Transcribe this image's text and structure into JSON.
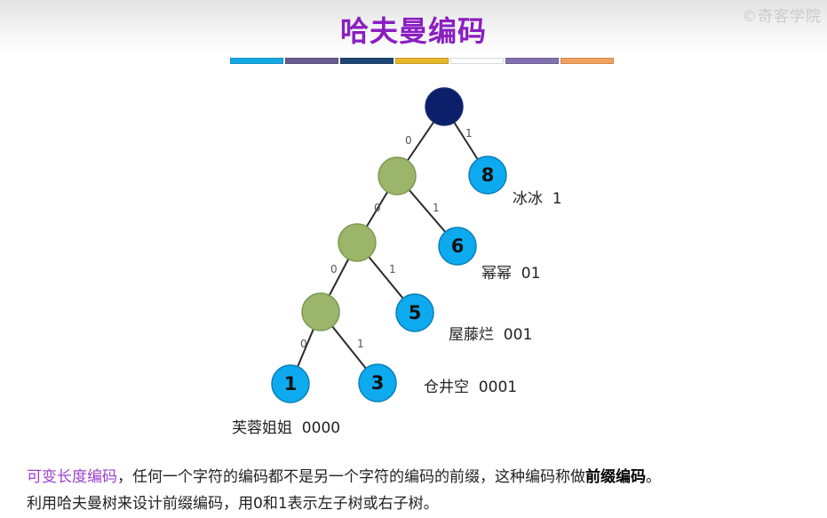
{
  "header": {
    "title": "哈夫曼编码",
    "watermark": "©奇客学院"
  },
  "title_bar_colors": [
    "#14a9e4",
    "#6b5c8f",
    "#1f4776",
    "#e8b62a",
    "#ffffff",
    "#8170ad",
    "#f2a15f"
  ],
  "tree": {
    "colors": {
      "root": "#0b1f6b",
      "internal": "#9bb56a",
      "leaf": "#0eaaef",
      "edge": "#2a2a2a"
    },
    "edges": [
      {
        "label": "0"
      },
      {
        "label": "1"
      },
      {
        "label": "0"
      },
      {
        "label": "1"
      },
      {
        "label": "0"
      },
      {
        "label": "1"
      },
      {
        "label": "0"
      },
      {
        "label": "1"
      }
    ],
    "leaves": [
      {
        "weight": "8",
        "label": "冰冰  1"
      },
      {
        "weight": "6",
        "label": "幂幂  01"
      },
      {
        "weight": "5",
        "label": "屋藤烂  001"
      },
      {
        "weight": "1",
        "label": "芙蓉姐姐  0000"
      },
      {
        "weight": "3",
        "label": "仓井空  0001"
      }
    ]
  },
  "caption": {
    "line1_highlight": "可变长度编码",
    "line1_text": "，任何一个字符的编码都不是另一个字符的编码的前缀，这种编码称做",
    "line1_bold": "前缀编码",
    "line1_end": "。",
    "line2": "利用哈夫曼树来设计前缀编码，用0和1表示左子树或右子树。"
  }
}
